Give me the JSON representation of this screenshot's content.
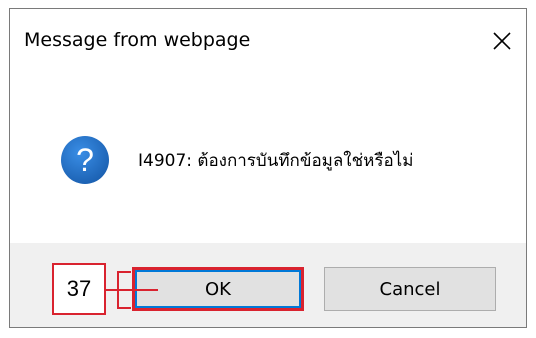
{
  "dialog": {
    "title": "Message from webpage",
    "close_icon": "close-icon",
    "message_icon": "question-icon",
    "message": "I4907: ต้องการบันทึกข้อมูลใช่หรือไม่",
    "ok_label": "OK",
    "cancel_label": "Cancel"
  },
  "annotation": {
    "number": "37",
    "color": "#d9232f"
  },
  "colors": {
    "footer_bg": "#f0f0f0",
    "button_bg": "#e1e1e1",
    "icon_blue": "#1f6fc5",
    "focus_blue": "#0078d7"
  }
}
